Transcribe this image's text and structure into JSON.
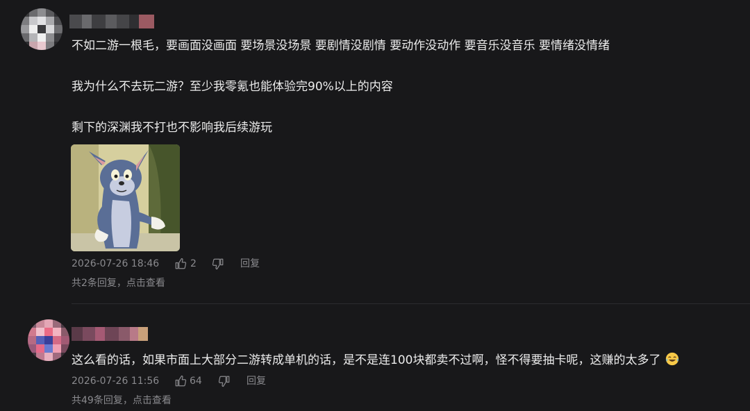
{
  "comments": [
    {
      "lines": [
        "不如二游一根毛，要画面没画面 要场景没场景 要剧情没剧情 要动作没动作 要音乐没音乐 要情绪没情绪",
        "我为什么不去玩二游？至少我零氪也能体验完90%以上的内容",
        "剩下的深渊我不打也不影响我后续游玩"
      ],
      "image_icon": "tom-cat-shrug-meme",
      "timestamp": "2026-07-26 18:46",
      "likes": "2",
      "reply_label": "回复",
      "replies_text": "共2条回复，点击查看"
    },
    {
      "lines": [
        "这么看的话，如果市面上大部分二游转成单机的话，是不是连100块都卖不过啊，怪不得要抽卡呢，这赚的太多了"
      ],
      "emoji_icon": "laughing-tears-emoji",
      "timestamp": "2026-07-26 11:56",
      "likes": "64",
      "reply_label": "回复",
      "replies_text": "共49条回复，点击查看"
    }
  ],
  "colors": {
    "background": "#18181a",
    "text": "#ececec",
    "meta": "#8a8a8e",
    "divider": "#2c2c30"
  }
}
